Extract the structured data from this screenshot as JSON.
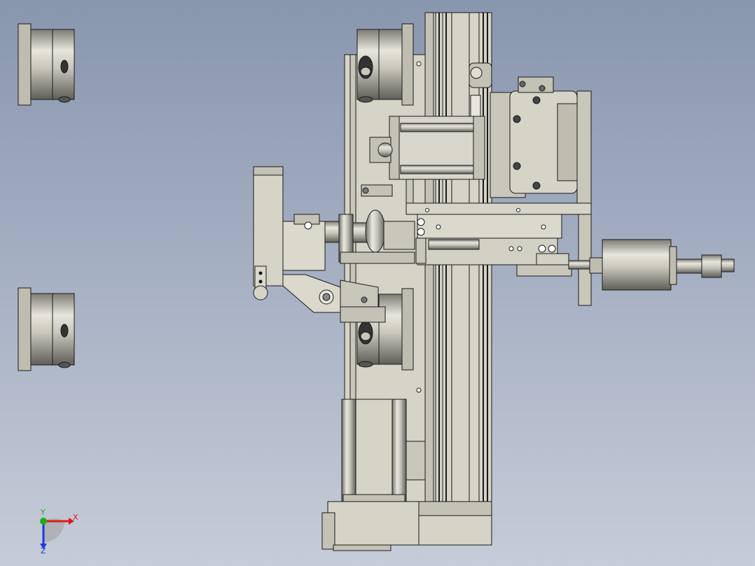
{
  "viewport": {
    "background_top": "#8896ae",
    "background_bottom": "#c6ccd8",
    "part_fill": "#d6d3c7",
    "part_shade": "#a9a79c",
    "edge_color": "#1a1a1a"
  },
  "triad": {
    "x_label": "X",
    "y_label": "Y",
    "z_label": "Z",
    "x_color": "#e01a1a",
    "y_color": "#1ab01a",
    "z_color": "#1a3ae0"
  }
}
